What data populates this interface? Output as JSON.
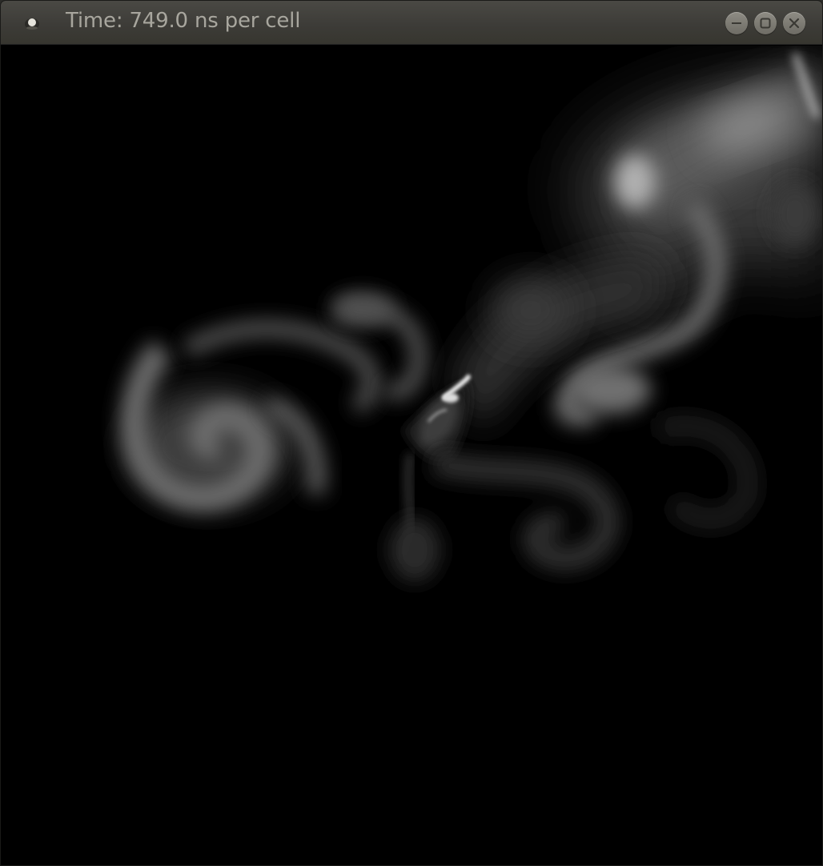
{
  "window": {
    "title": "Time: 749.0 ns per cell",
    "icons": {
      "app": "app-menu-icon",
      "minimize": "minimize-icon",
      "maximize": "maximize-icon",
      "close": "close-icon"
    }
  },
  "canvas": {
    "background": "#000000",
    "content": "smoke-density-simulation",
    "smoke_color": "#ffffff"
  }
}
